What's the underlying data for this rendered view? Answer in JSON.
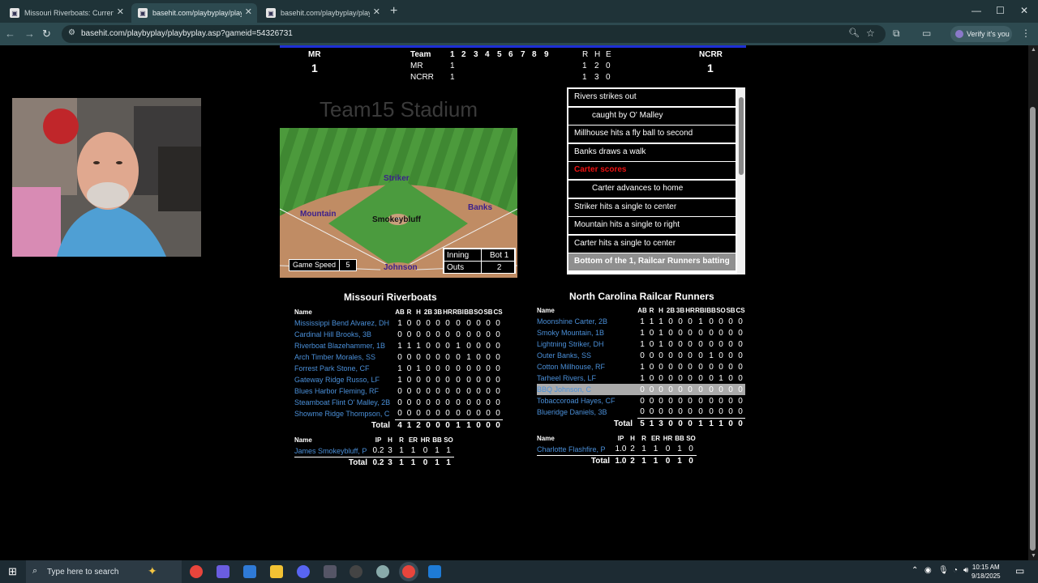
{
  "browser": {
    "tabs": [
      {
        "title": "Missouri Riverboats: Current Se",
        "active": false
      },
      {
        "title": "basehit.com/playbyplay/playbyp",
        "active": true
      },
      {
        "title": "basehit.com/playbyplay/playbyp",
        "active": false
      }
    ],
    "url": "basehit.com/playbyplay/playbyplay.asp?gameid=54326731",
    "verify_label": "Verify it's you"
  },
  "scoreboard": {
    "away_abbr": "MR",
    "away_runs": "1",
    "home_abbr": "NCRR",
    "home_runs": "1",
    "team_header": "Team",
    "innings": [
      "1",
      "2",
      "3",
      "4",
      "5",
      "6",
      "7",
      "8",
      "9"
    ],
    "rhe_headers": [
      "R",
      "H",
      "E"
    ],
    "rows": [
      {
        "team": "MR",
        "inn1": "1",
        "r": "1",
        "h": "2",
        "e": "0"
      },
      {
        "team": "NCRR",
        "inn1": "1",
        "r": "1",
        "h": "3",
        "e": "0"
      }
    ]
  },
  "stadium": {
    "title": "Team15 Stadium",
    "players": {
      "cf": "Striker",
      "lf": "Mountain",
      "rf": "Banks",
      "mound": "Smokeybluff",
      "home": "Johnson"
    },
    "game_speed_label": "Game Speed",
    "game_speed_value": "5",
    "inning_label": "Inning",
    "inning_value": "Bot 1",
    "outs_label": "Outs",
    "outs_value": "2"
  },
  "play_by_play": [
    {
      "text": "Rivers strikes out",
      "style": "normal"
    },
    {
      "text": "caught by O' Malley",
      "style": "indent"
    },
    {
      "text": "Millhouse hits a fly ball to second",
      "style": "normal"
    },
    {
      "text": "Banks draws a walk",
      "style": "normal"
    },
    {
      "text": "Carter scores",
      "style": "red"
    },
    {
      "text": "Carter advances to home",
      "style": "indent"
    },
    {
      "text": "Striker hits a single to center",
      "style": "normal"
    },
    {
      "text": "Mountain hits a single to right",
      "style": "normal"
    },
    {
      "text": "Carter hits a single to center",
      "style": "normal"
    },
    {
      "text": "Bottom of the 1, Railcar Runners batting",
      "style": "header"
    }
  ],
  "away_box": {
    "team_name": "Missouri Riverboats",
    "headers": [
      "Name",
      "AB",
      "R",
      "H",
      "2B",
      "3B",
      "HR",
      "RBI",
      "BB",
      "SO",
      "SB",
      "CS"
    ],
    "batters": [
      {
        "name": "Mississippi Bend Alvarez, DH",
        "stats": [
          "1",
          "0",
          "0",
          "0",
          "0",
          "0",
          "0",
          "0",
          "0",
          "0",
          "0"
        ]
      },
      {
        "name": "Cardinal Hill Brooks, 3B",
        "stats": [
          "0",
          "0",
          "0",
          "0",
          "0",
          "0",
          "0",
          "0",
          "0",
          "0",
          "0"
        ]
      },
      {
        "name": "Riverboat Blazehammer, 1B",
        "stats": [
          "1",
          "1",
          "1",
          "0",
          "0",
          "0",
          "1",
          "0",
          "0",
          "0",
          "0"
        ]
      },
      {
        "name": "Arch Timber Morales, SS",
        "stats": [
          "0",
          "0",
          "0",
          "0",
          "0",
          "0",
          "0",
          "1",
          "0",
          "0",
          "0"
        ]
      },
      {
        "name": "Forrest Park Stone, CF",
        "stats": [
          "1",
          "0",
          "1",
          "0",
          "0",
          "0",
          "0",
          "0",
          "0",
          "0",
          "0"
        ]
      },
      {
        "name": "Gateway Ridge Russo, LF",
        "stats": [
          "1",
          "0",
          "0",
          "0",
          "0",
          "0",
          "0",
          "0",
          "0",
          "0",
          "0"
        ]
      },
      {
        "name": "Blues Harbor Fleming, RF",
        "stats": [
          "0",
          "0",
          "0",
          "0",
          "0",
          "0",
          "0",
          "0",
          "0",
          "0",
          "0"
        ]
      },
      {
        "name": "Steamboat Flint O' Malley, 2B",
        "stats": [
          "0",
          "0",
          "0",
          "0",
          "0",
          "0",
          "0",
          "0",
          "0",
          "0",
          "0"
        ]
      },
      {
        "name": "Showme Ridge Thompson, C",
        "stats": [
          "0",
          "0",
          "0",
          "0",
          "0",
          "0",
          "0",
          "0",
          "0",
          "0",
          "0"
        ]
      }
    ],
    "total_label": "Total",
    "totals": [
      "4",
      "1",
      "2",
      "0",
      "0",
      "0",
      "1",
      "1",
      "0",
      "0",
      "0"
    ],
    "pitch_headers": [
      "Name",
      "IP",
      "H",
      "R",
      "ER",
      "HR",
      "BB",
      "SO"
    ],
    "pitchers": [
      {
        "name": "James Smokeybluff, P",
        "stats": [
          "0.2",
          "3",
          "1",
          "1",
          "0",
          "1",
          "1"
        ]
      }
    ],
    "pitch_totals": [
      "0.2",
      "3",
      "1",
      "1",
      "0",
      "1",
      "1"
    ]
  },
  "home_box": {
    "team_name": "North Carolina Railcar Runners",
    "headers": [
      "Name",
      "AB",
      "R",
      "H",
      "2B",
      "3B",
      "HR",
      "RBI",
      "BB",
      "SO",
      "SB",
      "CS"
    ],
    "batters": [
      {
        "name": "Moonshine Carter, 2B",
        "stats": [
          "1",
          "1",
          "1",
          "0",
          "0",
          "0",
          "1",
          "0",
          "0",
          "0",
          "0"
        ]
      },
      {
        "name": "Smoky Mountain, 1B",
        "stats": [
          "1",
          "0",
          "1",
          "0",
          "0",
          "0",
          "0",
          "0",
          "0",
          "0",
          "0"
        ]
      },
      {
        "name": "Lightning Striker, DH",
        "stats": [
          "1",
          "0",
          "1",
          "0",
          "0",
          "0",
          "0",
          "0",
          "0",
          "0",
          "0"
        ]
      },
      {
        "name": "Outer Banks, SS",
        "stats": [
          "0",
          "0",
          "0",
          "0",
          "0",
          "0",
          "0",
          "1",
          "0",
          "0",
          "0"
        ]
      },
      {
        "name": "Cotton Millhouse, RF",
        "stats": [
          "1",
          "0",
          "0",
          "0",
          "0",
          "0",
          "0",
          "0",
          "0",
          "0",
          "0"
        ]
      },
      {
        "name": "Tarheel Rivers, LF",
        "stats": [
          "1",
          "0",
          "0",
          "0",
          "0",
          "0",
          "0",
          "0",
          "1",
          "0",
          "0"
        ]
      },
      {
        "name": "BBQ Johnson, C",
        "stats": [
          "0",
          "0",
          "0",
          "0",
          "0",
          "0",
          "0",
          "0",
          "0",
          "0",
          "0"
        ],
        "current": true
      },
      {
        "name": "Tobaccoroad Hayes, CF",
        "stats": [
          "0",
          "0",
          "0",
          "0",
          "0",
          "0",
          "0",
          "0",
          "0",
          "0",
          "0"
        ]
      },
      {
        "name": "Blueridge Daniels, 3B",
        "stats": [
          "0",
          "0",
          "0",
          "0",
          "0",
          "0",
          "0",
          "0",
          "0",
          "0",
          "0"
        ]
      }
    ],
    "total_label": "Total",
    "totals": [
      "5",
      "1",
      "3",
      "0",
      "0",
      "0",
      "1",
      "1",
      "1",
      "0",
      "0"
    ],
    "pitch_headers": [
      "Name",
      "IP",
      "H",
      "R",
      "ER",
      "HR",
      "BB",
      "SO"
    ],
    "pitchers": [
      {
        "name": "Charlotte Flashfire, P",
        "stats": [
          "1.0",
          "2",
          "1",
          "1",
          "0",
          "1",
          "0"
        ]
      }
    ],
    "pitch_totals": [
      "1.0",
      "2",
      "1",
      "1",
      "0",
      "1",
      "0"
    ]
  },
  "taskbar": {
    "search_placeholder": "Type here to search",
    "time": "10:15 AM",
    "date": "9/18/2025"
  }
}
